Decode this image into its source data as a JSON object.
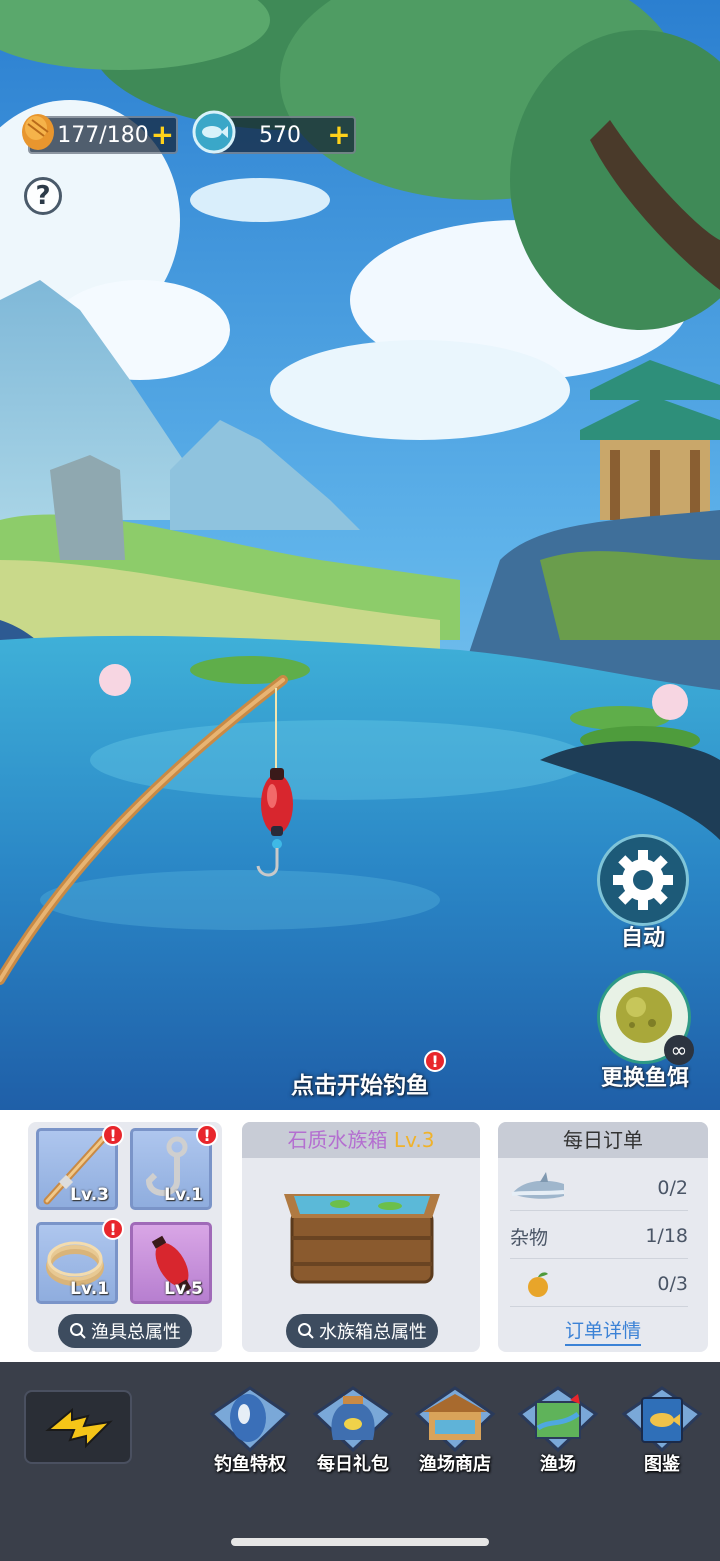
{
  "resources": {
    "stamina": "177/180",
    "coins": "570",
    "plus_symbol": "+"
  },
  "help": {
    "symbol": "?"
  },
  "scene": {
    "start_hint": "点击开始钓鱼",
    "alert_symbol": "!"
  },
  "side_buttons": {
    "auto_label": "自动",
    "bait_label": "更换鱼饵",
    "bait_count": "∞"
  },
  "gear_panel": {
    "slots": [
      {
        "name": "rod",
        "level": "Lv.3"
      },
      {
        "name": "hook",
        "level": "Lv.1"
      },
      {
        "name": "line",
        "level": "Lv.1"
      },
      {
        "name": "float",
        "level": "Lv.5"
      }
    ],
    "attributes_label": "渔具总属性"
  },
  "aquarium_panel": {
    "title": "石质水族箱",
    "level": "Lv.3",
    "attributes_label": "水族箱总属性"
  },
  "daily_orders": {
    "title": "每日订单",
    "rows": [
      {
        "item": "",
        "icon": "dolphin-icon",
        "count": "0/2"
      },
      {
        "item": "杂物",
        "icon": "",
        "count": "1/18"
      },
      {
        "item": "",
        "icon": "fruit-icon",
        "count": "0/3"
      }
    ],
    "details_link": "订单详情"
  },
  "bottom_nav": {
    "items": [
      {
        "label": "钓鱼特权",
        "icon": "fish-privilege-icon"
      },
      {
        "label": "每日礼包",
        "icon": "gift-bag-icon"
      },
      {
        "label": "渔场商店",
        "icon": "shop-icon"
      },
      {
        "label": "渔场",
        "icon": "map-icon"
      },
      {
        "label": "图鉴",
        "icon": "book-icon"
      }
    ]
  },
  "colors": {
    "accent_yellow": "#ffd21a",
    "title_purple": "#b46fd0",
    "level_gold": "#f0b22a",
    "link_blue": "#3b82d6"
  }
}
